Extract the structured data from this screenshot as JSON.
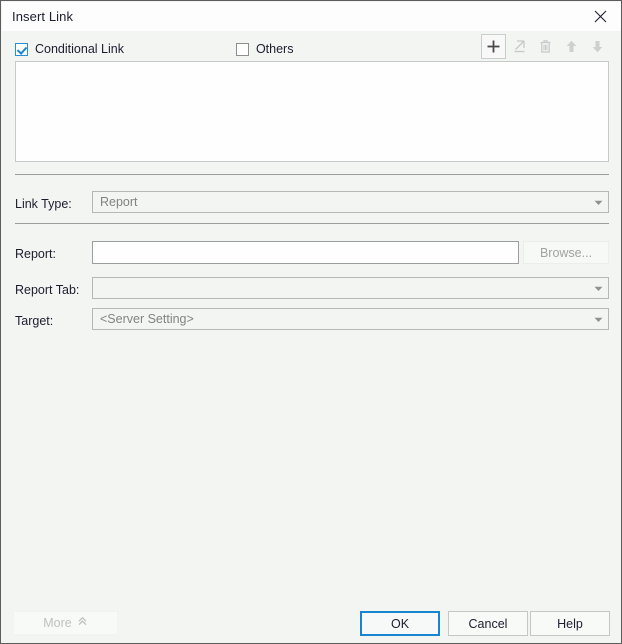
{
  "window": {
    "title": "Insert Link",
    "close_icon": "close-icon"
  },
  "options": {
    "conditional_link": {
      "label": "Conditional Link",
      "checked": true
    },
    "others": {
      "label": "Others",
      "checked": false
    }
  },
  "toolbar": {
    "add": {
      "name": "add-icon",
      "enabled": true
    },
    "edit": {
      "name": "edit-pencil-icon",
      "enabled": false
    },
    "delete": {
      "name": "delete-trash-icon",
      "enabled": false
    },
    "move_up": {
      "name": "arrow-up-icon",
      "enabled": false
    },
    "move_down": {
      "name": "arrow-down-icon",
      "enabled": false
    }
  },
  "list": {
    "items": []
  },
  "fields": {
    "link_type": {
      "label": "Link Type:",
      "value": "Report"
    },
    "report": {
      "label": "Report:",
      "value": "",
      "placeholder": ""
    },
    "browse": {
      "label": "Browse...",
      "enabled": false
    },
    "report_tab": {
      "label": "Report Tab:",
      "value": ""
    },
    "target": {
      "label": "Target:",
      "value": "<Server Setting>"
    }
  },
  "footer": {
    "more": {
      "label": "More",
      "chevron": "chevron-up-double-icon",
      "enabled": false
    },
    "ok": "OK",
    "cancel": "Cancel",
    "help": "Help"
  },
  "colors": {
    "accent": "#1586cf",
    "checkbox_check": "#1886cd",
    "dialog_bg": "#f3f5f3",
    "titlebar_bg": "#fcfdfc",
    "border": "#5c5c5c"
  }
}
